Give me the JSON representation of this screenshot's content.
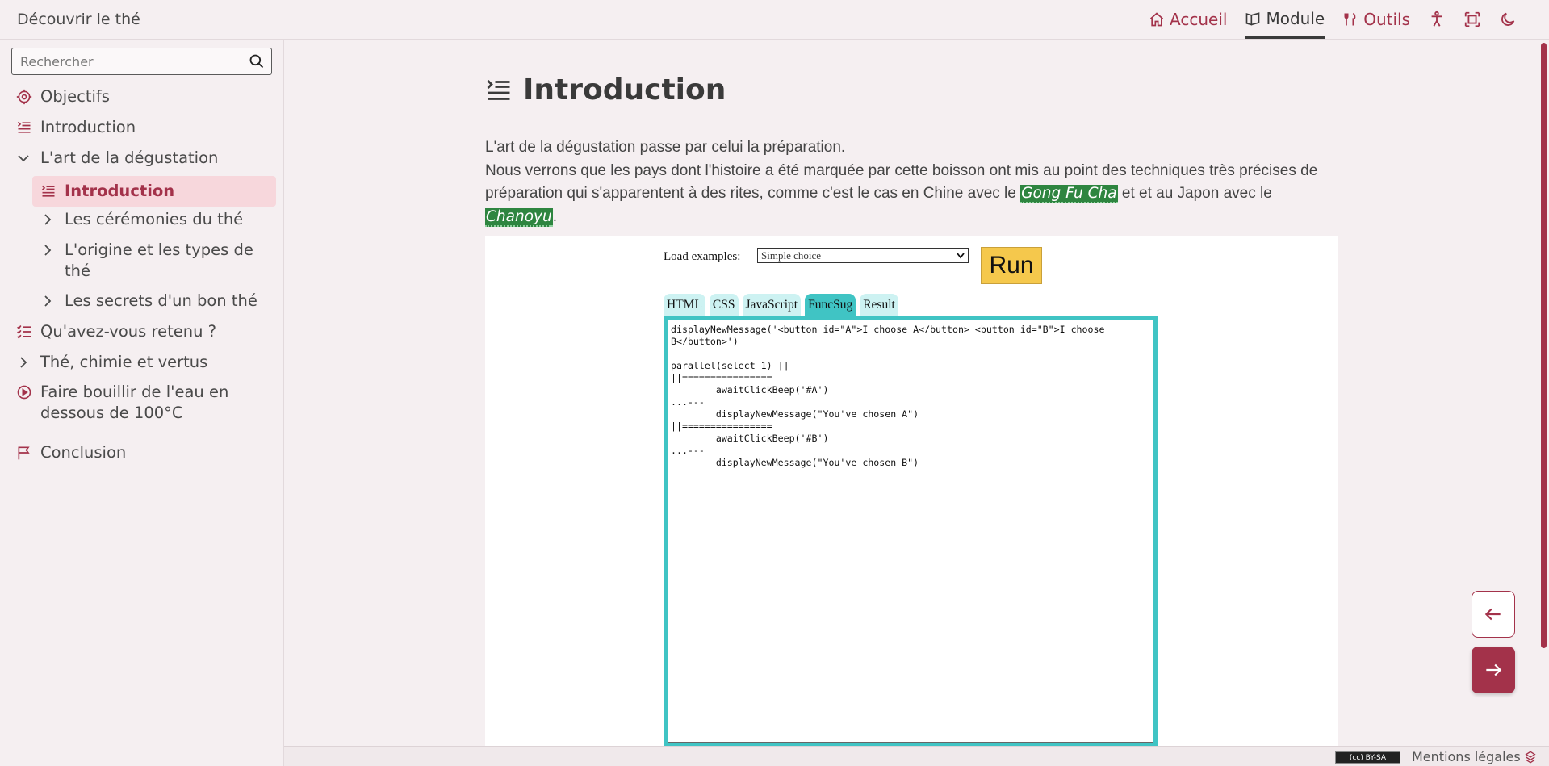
{
  "header": {
    "site_title": "Découvrir le thé",
    "nav": [
      {
        "label": "Accueil",
        "icon": "home-icon"
      },
      {
        "label": "Module",
        "icon": "book-icon"
      },
      {
        "label": "Outils",
        "icon": "tools-icon"
      }
    ],
    "icons": [
      "accessibility-icon",
      "fullscreen-icon",
      "dark-mode-icon"
    ]
  },
  "sidebar": {
    "search_placeholder": "Rechercher",
    "items": [
      {
        "label": "Objectifs",
        "icon": "target-icon"
      },
      {
        "label": "Introduction",
        "icon": "intro-icon"
      },
      {
        "label": "L'art de la dégustation",
        "icon": "chevron-down-icon"
      },
      {
        "label": "Introduction",
        "icon": "intro-icon",
        "active": true
      },
      {
        "label": "Les cérémonies du thé",
        "icon": "chevron-right-icon"
      },
      {
        "label": "L'origine et les types de thé",
        "icon": "chevron-right-icon"
      },
      {
        "label": "Les secrets d'un bon thé",
        "icon": "chevron-right-icon"
      },
      {
        "label": "Qu'avez-vous retenu ?",
        "icon": "checklist-icon"
      },
      {
        "label": "Thé, chimie et vertus",
        "icon": "chevron-right-icon"
      },
      {
        "label": "Faire bouillir de l'eau en dessous de 100°C",
        "icon": "play-circle-icon"
      },
      {
        "label": "Conclusion",
        "icon": "flag-icon"
      }
    ]
  },
  "main": {
    "title": "Introduction",
    "para1": "L'art de la dégustation passe par celui la préparation.",
    "para2_a": "Nous verrons que les pays dont l'histoire a été marquée par cette boisson ont mis au point des techniques très précises de préparation qui s'apparentent à des rites, comme c'est le cas en Chine avec le ",
    "term1": "Gong Fu Cha",
    "para2_b": " et et au Japon avec le ",
    "term2": "Chanoyu",
    "para2_c": "."
  },
  "editor": {
    "load_label": "Load examples:",
    "selected_example": "Simple choice",
    "run_label": "Run",
    "tabs": [
      "HTML",
      "CSS",
      "JavaScript",
      "FuncSug",
      "Result"
    ],
    "active_tab": "FuncSug",
    "code": "displayNewMessage('<button id=\"A\">I choose A</button> <button id=\"B\">I choose\nB</button>')\n\nparallel(select 1) ||\n||================\n        awaitClickBeep('#A')\n...---\n        displayNewMessage(\"You've chosen A\")\n||================\n        awaitClickBeep('#B')\n...---\n        displayNewMessage(\"You've chosen B\")"
  },
  "footer": {
    "license": "(cc) BY-SA",
    "legal": "Mentions légales"
  },
  "colors": {
    "accent": "#a3324a",
    "background": "#f5eff1",
    "highlight": "#2e8540",
    "editor_teal": "#40c4c4",
    "run_button": "#f5c84c"
  }
}
